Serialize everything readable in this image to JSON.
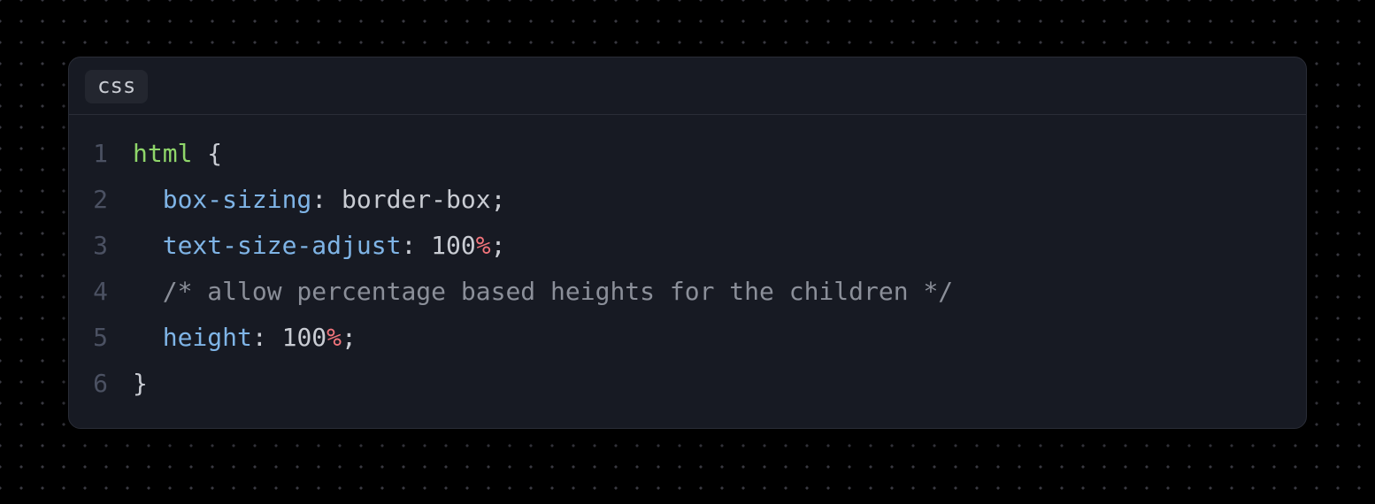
{
  "language_badge": "css",
  "lines": [
    {
      "num": "1",
      "tokens": [
        {
          "cls": "tok-selector",
          "text": "html"
        },
        {
          "cls": "tok-punct",
          "text": " {"
        }
      ]
    },
    {
      "num": "2",
      "tokens": [
        {
          "cls": "tok-punct",
          "text": "  "
        },
        {
          "cls": "tok-prop",
          "text": "box-sizing"
        },
        {
          "cls": "tok-punct",
          "text": ": "
        },
        {
          "cls": "tok-value",
          "text": "border-box"
        },
        {
          "cls": "tok-punct",
          "text": ";"
        }
      ]
    },
    {
      "num": "3",
      "tokens": [
        {
          "cls": "tok-punct",
          "text": "  "
        },
        {
          "cls": "tok-prop",
          "text": "text-size-adjust"
        },
        {
          "cls": "tok-punct",
          "text": ": "
        },
        {
          "cls": "tok-number",
          "text": "100"
        },
        {
          "cls": "tok-unit",
          "text": "%"
        },
        {
          "cls": "tok-punct",
          "text": ";"
        }
      ]
    },
    {
      "num": "4",
      "tokens": [
        {
          "cls": "tok-punct",
          "text": "  "
        },
        {
          "cls": "tok-comment",
          "text": "/* allow percentage based heights for the children */"
        }
      ]
    },
    {
      "num": "5",
      "tokens": [
        {
          "cls": "tok-punct",
          "text": "  "
        },
        {
          "cls": "tok-prop",
          "text": "height"
        },
        {
          "cls": "tok-punct",
          "text": ": "
        },
        {
          "cls": "tok-number",
          "text": "100"
        },
        {
          "cls": "tok-unit",
          "text": "%"
        },
        {
          "cls": "tok-punct",
          "text": ";"
        }
      ]
    },
    {
      "num": "6",
      "tokens": [
        {
          "cls": "tok-punct",
          "text": "}"
        }
      ]
    }
  ]
}
